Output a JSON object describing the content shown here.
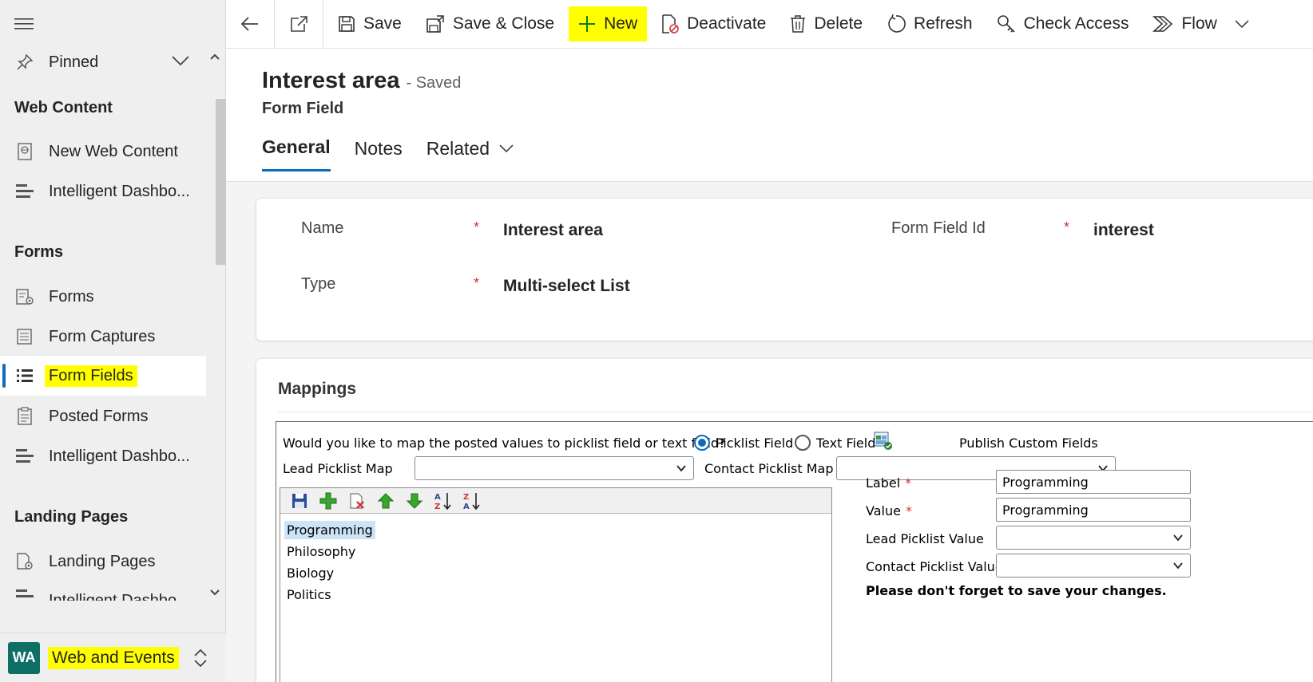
{
  "sidebar": {
    "pinned_label": "Pinned",
    "sections": [
      {
        "title": "Web Content",
        "items": [
          {
            "label": "New Web Content",
            "icon": "web-content-icon"
          },
          {
            "label": "Intelligent Dashbo...",
            "icon": "dashboard-icon"
          }
        ]
      },
      {
        "title": "Forms",
        "items": [
          {
            "label": "Forms",
            "icon": "form-settings-icon"
          },
          {
            "label": "Form Captures",
            "icon": "form-capture-icon"
          },
          {
            "label": "Form Fields",
            "icon": "list-icon",
            "selected": true
          },
          {
            "label": "Posted Forms",
            "icon": "clipboard-icon"
          },
          {
            "label": "Intelligent Dashbo...",
            "icon": "dashboard-icon"
          }
        ]
      },
      {
        "title": "Landing Pages",
        "items": [
          {
            "label": "Landing Pages",
            "icon": "page-settings-icon"
          },
          {
            "label": "Intelligent Dashbo...",
            "icon": "dashboard-icon"
          }
        ]
      }
    ],
    "area": {
      "initials": "WA",
      "label": "Web and Events",
      "avatar_color": "#0e6f66"
    }
  },
  "toolbar": {
    "save": "Save",
    "save_close": "Save & Close",
    "new": "New",
    "deactivate": "Deactivate",
    "delete": "Delete",
    "refresh": "Refresh",
    "check_access": "Check Access",
    "flow": "Flow"
  },
  "record": {
    "title": "Interest area",
    "status": "- Saved",
    "entity": "Form Field",
    "tabs": [
      "General",
      "Notes",
      "Related"
    ]
  },
  "general": {
    "name_label": "Name",
    "name_value": "Interest area",
    "form_field_id_label": "Form Field Id",
    "form_field_id_value": "interest",
    "type_label": "Type",
    "type_value": "Multi-select List",
    "required_mark": "*"
  },
  "mappings": {
    "title": "Mappings",
    "question": "Would you like to map the posted values to picklist field or text field?",
    "picklist_option": "Picklist Field",
    "text_option": "Text Field",
    "publish_label": "Publish Custom Fields",
    "lead_map_label": "Lead Picklist Map",
    "contact_map_label": "Contact Picklist Map",
    "options": [
      {
        "label": "Programming",
        "selected": true
      },
      {
        "label": "Philosophy"
      },
      {
        "label": "Biology"
      },
      {
        "label": "Politics"
      }
    ],
    "label_label": "Label",
    "label_value": "Programming",
    "value_label": "Value",
    "value_value": "Programming",
    "lead_value_label": "Lead Picklist Value",
    "contact_value_label": "Contact Picklist Value",
    "warning": "Please don't forget to save your changes."
  },
  "colors": {
    "accent": "#0f6cbd",
    "highlight": "#ffff00",
    "required": "#d13438"
  }
}
